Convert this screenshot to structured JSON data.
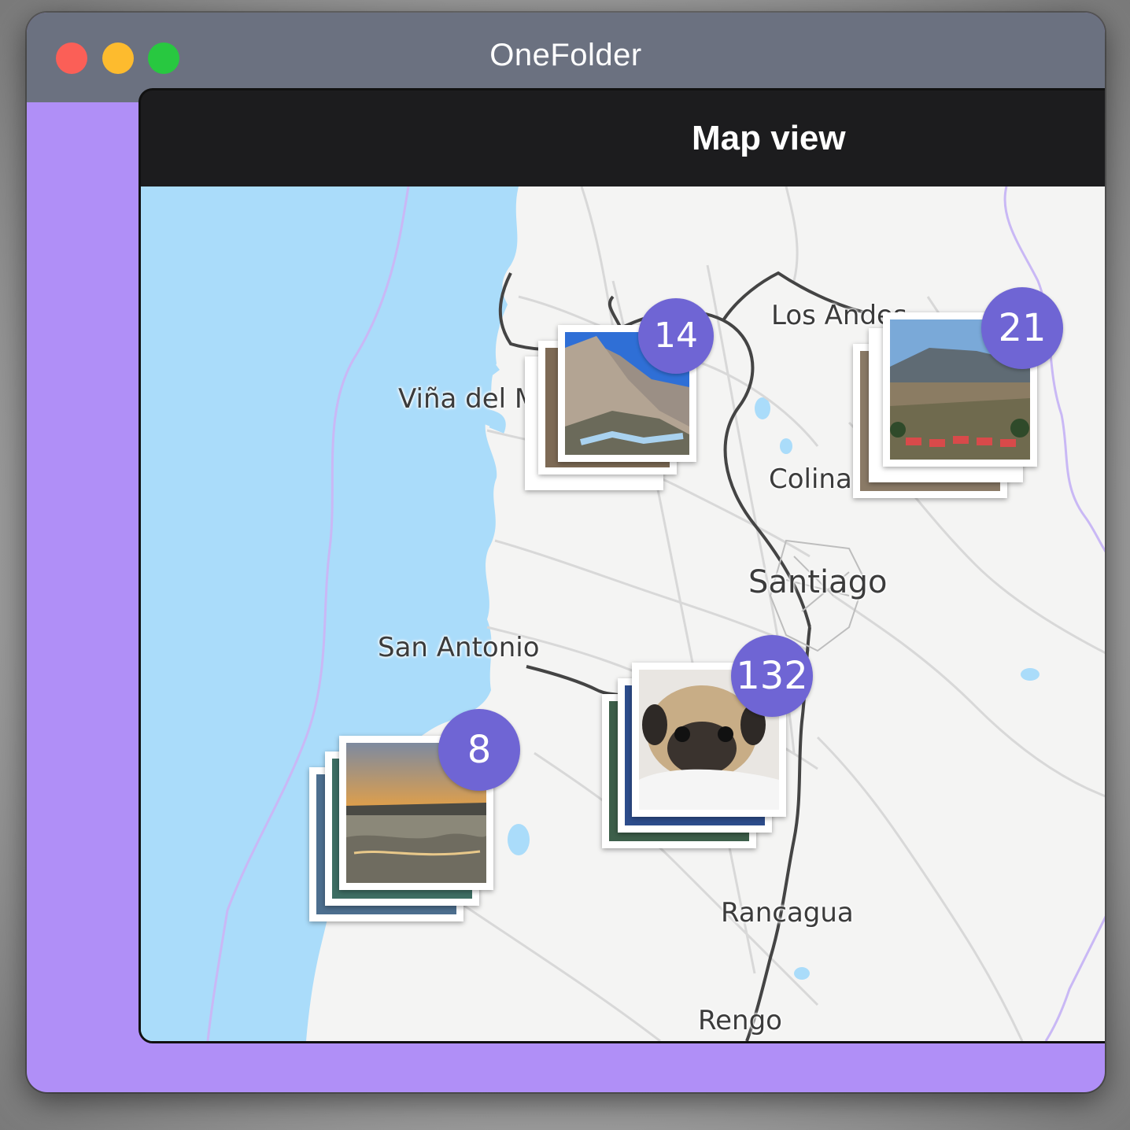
{
  "window": {
    "title": "OneFolder",
    "controls": [
      "close-button",
      "minimize-button",
      "zoom-button"
    ]
  },
  "panel": {
    "title": "Map view"
  },
  "map": {
    "places": [
      {
        "id": "los-andes",
        "label": "Los Andes"
      },
      {
        "id": "vina-del-mar",
        "label": "Viña del M"
      },
      {
        "id": "colina",
        "label": "Colina"
      },
      {
        "id": "santiago",
        "label": "Santiago"
      },
      {
        "id": "san-antonio",
        "label": "San Antonio"
      },
      {
        "id": "rancagua",
        "label": "Rancagua"
      },
      {
        "id": "rengo",
        "label": "Rengo"
      }
    ],
    "clusters": [
      {
        "id": "cluster-valparaiso",
        "count": "14",
        "photo": "mountain valley"
      },
      {
        "id": "cluster-los-andes",
        "count": "21",
        "photo": "mountain town"
      },
      {
        "id": "cluster-santiago",
        "count": "132",
        "photo": "pug dog"
      },
      {
        "id": "cluster-coast",
        "count": "8",
        "photo": "sunset sea"
      }
    ]
  },
  "colors": {
    "titlebar": "#6b7180",
    "window_bg": "#b08ff7",
    "panel_header": "#1c1c1e",
    "water": "#aadcfa",
    "land": "#f4f4f3",
    "badge": "#6f65d4",
    "border_line": "#c9b8f5"
  }
}
